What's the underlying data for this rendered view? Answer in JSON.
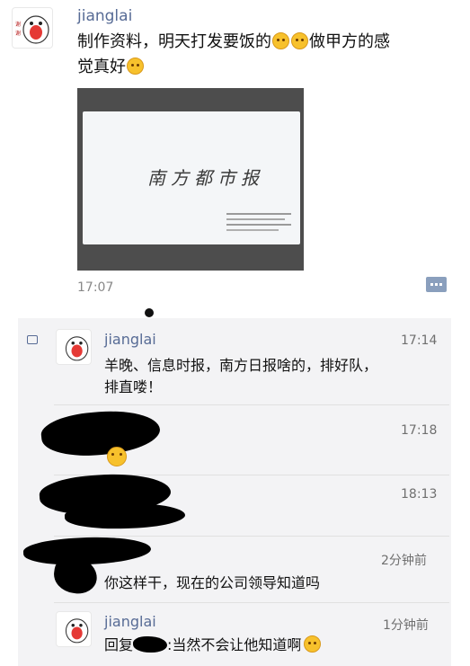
{
  "post": {
    "author": "jianglai",
    "text_line1": "制作资料，明天打发要饭的",
    "text_line1b": "做甲方的感",
    "text_line2": "觉真好",
    "time": "17:07",
    "photo_title": "南方都市报"
  },
  "comments": [
    {
      "author": "jianglai",
      "time": "17:14",
      "text_line1": "羊晚、信息时报，南方日报啥的，排好队，",
      "text_line2": "排直喽！"
    },
    {
      "author": "",
      "time": "17:18",
      "text": ""
    },
    {
      "author": "",
      "time": "18:13",
      "text": ""
    },
    {
      "author": "",
      "time": "2分钟前",
      "text": "你这样干，现在的公司领导知道吗"
    },
    {
      "author": "jianglai",
      "time": "1分钟前",
      "reply_prefix": "回复",
      "text": ":当然不会让他知道啊"
    }
  ],
  "icons": {
    "more": "more-dots-icon",
    "comment": "comment-icon",
    "emoji": "emoji-icon"
  },
  "colors": {
    "name": "#576b95",
    "comment_bg": "#f3f3f5"
  }
}
